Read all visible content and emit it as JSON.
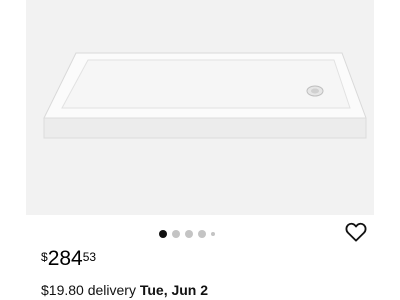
{
  "product": {
    "image": {
      "alt_icon": "shower-base-image",
      "background": "#f2f2f2"
    },
    "carousel": {
      "count": 5,
      "active": 0
    },
    "price": {
      "currency": "$",
      "dollars": "284",
      "cents": "53"
    },
    "delivery": {
      "fee": "$19.80 delivery",
      "date": "Tue, Jun 2"
    },
    "favorite_icon": "heart-outline-icon"
  }
}
